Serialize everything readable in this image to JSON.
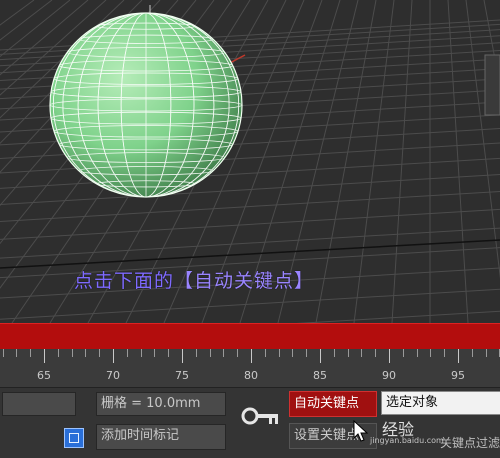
{
  "viewport": {
    "instruction_prefix": "点击下面的",
    "instruction_highlight": "【自动关键点】",
    "colors": {
      "sphere": "#7fd28b",
      "wire": "#ffffff",
      "grid": "#4a4a4a",
      "caption": "#7f6bff"
    }
  },
  "timeline": {
    "track_color": "#b30d0d",
    "ruler_numbers": [
      "65",
      "70",
      "75",
      "80",
      "85",
      "90",
      "95"
    ]
  },
  "controls": {
    "grid_label": "栅格 = 10.0mm",
    "add_time_tag_label": "添加时间标记",
    "auto_key_label": "自动关键点",
    "set_key_label": "设置关键点",
    "selected_object_label": "选定对象",
    "key_filters_partial": "关键点过滤器"
  },
  "watermark": {
    "label": "经验",
    "url": "jingyan.baidu.com"
  }
}
